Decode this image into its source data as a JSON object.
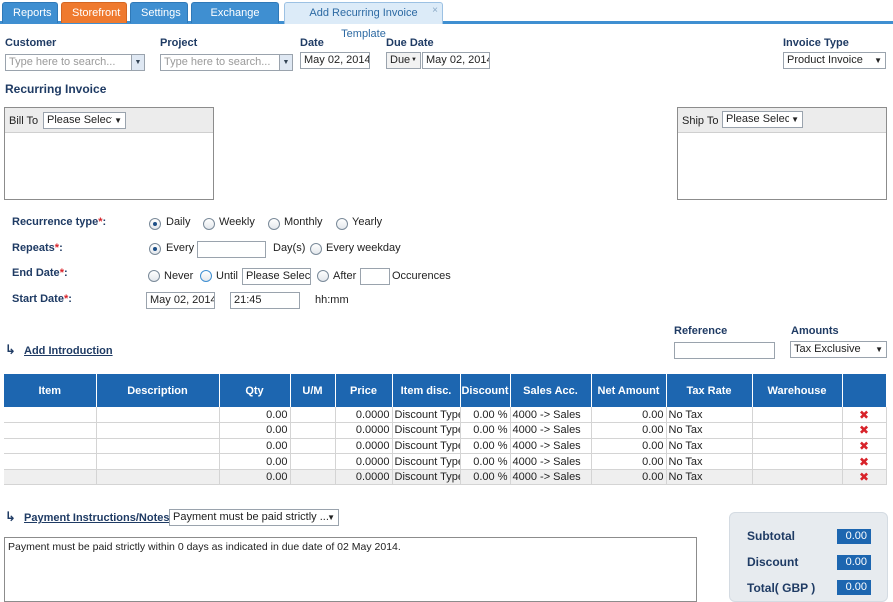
{
  "tabs": [
    {
      "label": "Reports"
    },
    {
      "label": "Storefront"
    },
    {
      "label": "Settings"
    },
    {
      "label": "Exchange Rate"
    },
    {
      "label": "Add Recurring Invoice Template",
      "close": "×"
    }
  ],
  "header": {
    "customer_label": "Customer",
    "customer_placeholder": "Type here to search...",
    "project_label": "Project",
    "project_placeholder": "Type here to search...",
    "date_label": "Date",
    "date_value": "May 02, 2014",
    "due_date_label": "Due Date",
    "due_mode": "Due",
    "due_date_value": "May 02, 2014",
    "invoice_type_label": "Invoice Type",
    "invoice_type_value": "Product Invoice"
  },
  "recurring": {
    "title": "Recurring Invoice",
    "bill_to_label": "Bill To",
    "bill_to_value": "Please Select",
    "ship_to_label": "Ship To",
    "ship_to_value": "Please Select"
  },
  "recurrence": {
    "type_label": "Recurrence type",
    "types": [
      "Daily",
      "Weekly",
      "Monthly",
      "Yearly"
    ],
    "selected_type": "Daily",
    "repeats_label": "Repeats",
    "every_label": "Every",
    "every_value": "",
    "days_label": "Day(s)",
    "every_weekday_label": "Every weekday",
    "end_date_label": "End Date",
    "never_label": "Never",
    "until_label": "Until",
    "until_value": "Please Select",
    "after_label": "After",
    "after_value": "",
    "occurences_label": "Occurences",
    "start_date_label": "Start Date",
    "start_date_value": "May 02, 2014",
    "start_time_value": "21:45",
    "time_format": "hh:mm",
    "required_mark": "*",
    "colon": ":"
  },
  "intro": {
    "link": "Add Introduction",
    "reference_label": "Reference",
    "reference_value": "",
    "amounts_label": "Amounts",
    "amounts_value": "Tax Exclusive"
  },
  "table": {
    "columns": [
      "Item",
      "Description",
      "Qty",
      "U/M",
      "Price",
      "Item disc.",
      "Discount",
      "Sales Acc.",
      "Net Amount",
      "Tax Rate",
      "Warehouse",
      ""
    ],
    "rows": [
      {
        "item": "",
        "desc": "",
        "qty": "0.00",
        "um": "",
        "price": "0.0000",
        "item_disc": "Discount Type",
        "discount": "0.00 %",
        "sales_acc": "4000 -> Sales",
        "net": "0.00",
        "tax": "No Tax",
        "warehouse": ""
      },
      {
        "item": "",
        "desc": "",
        "qty": "0.00",
        "um": "",
        "price": "0.0000",
        "item_disc": "Discount Type",
        "discount": "0.00 %",
        "sales_acc": "4000 -> Sales",
        "net": "0.00",
        "tax": "No Tax",
        "warehouse": ""
      },
      {
        "item": "",
        "desc": "",
        "qty": "0.00",
        "um": "",
        "price": "0.0000",
        "item_disc": "Discount Type",
        "discount": "0.00 %",
        "sales_acc": "4000 -> Sales",
        "net": "0.00",
        "tax": "No Tax",
        "warehouse": ""
      },
      {
        "item": "",
        "desc": "",
        "qty": "0.00",
        "um": "",
        "price": "0.0000",
        "item_disc": "Discount Type",
        "discount": "0.00 %",
        "sales_acc": "4000 -> Sales",
        "net": "0.00",
        "tax": "No Tax",
        "warehouse": ""
      },
      {
        "item": "",
        "desc": "",
        "qty": "0.00",
        "um": "",
        "price": "0.0000",
        "item_disc": "Discount Type",
        "discount": "0.00 %",
        "sales_acc": "4000 -> Sales",
        "net": "0.00",
        "tax": "No Tax",
        "warehouse": ""
      }
    ],
    "delete_icon": "✖"
  },
  "notes": {
    "link": "Payment Instructions/Notes:",
    "select_value": "Payment must be paid strictly ...",
    "text": "Payment must be paid strictly within 0 days as indicated in due date of 02 May 2014."
  },
  "totals": {
    "subtotal_label": "Subtotal",
    "subtotal_value": "0.00",
    "discount_label": "Discount",
    "discount_value": "0.00",
    "total_label": "Total( GBP )",
    "total_value": "0.00"
  },
  "icons": {
    "arrow": "↳",
    "dropdown": "▼"
  },
  "colors": {
    "accent": "#1d66b0",
    "tab_blue": "#3f8fd1",
    "tab_orange": "#ef7a2f",
    "required": "#d8232a"
  }
}
